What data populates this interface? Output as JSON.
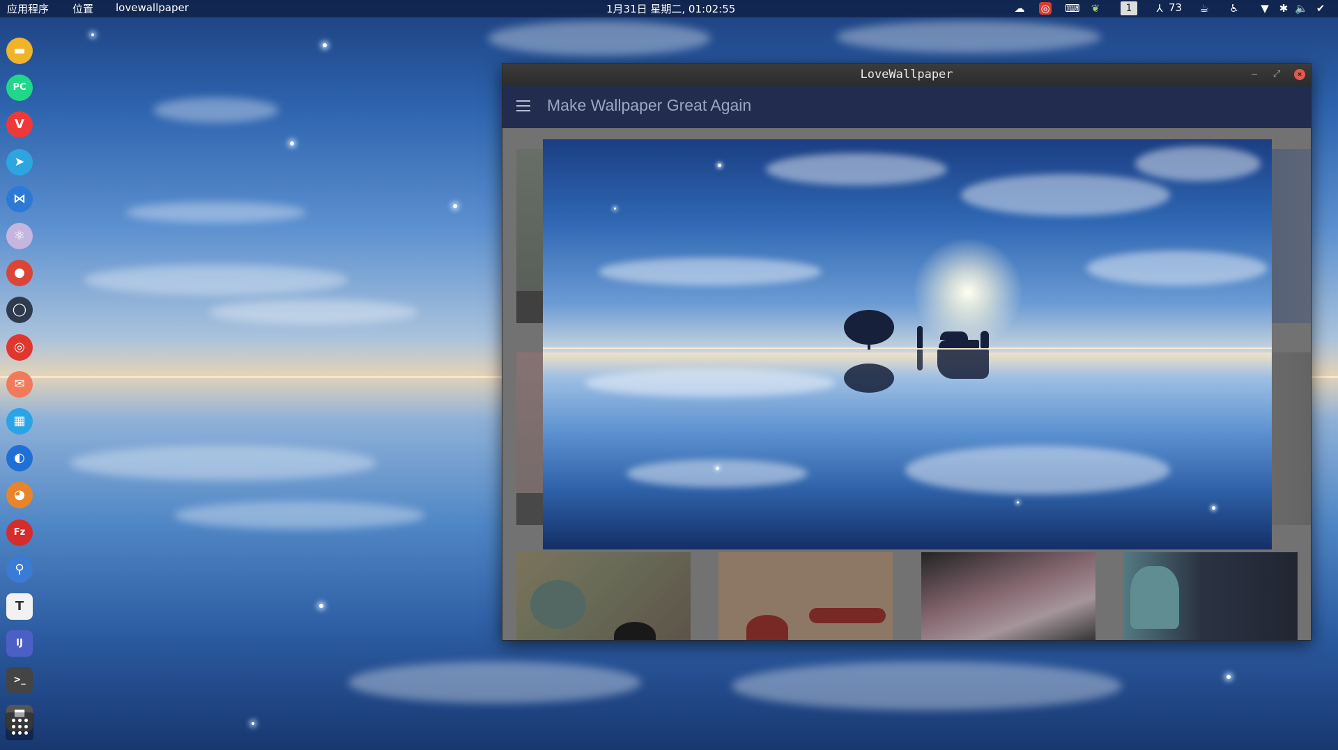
{
  "top_panel": {
    "applications": "应用程序",
    "places": "位置",
    "active_app": "lovewallpaper",
    "clock": "1月31日 星期二, 01:02:55",
    "workspace": "1",
    "temperature": "73"
  },
  "tray_icons": [
    "wechat-icon",
    "netease-music-icon",
    "keyboard-icon",
    "leaf-icon",
    "workspace-indicator",
    "temperature-icon",
    "coffee-icon",
    "accessibility-icon",
    "wifi-icon",
    "bluetooth-icon",
    "volume-icon",
    "clipboard-icon"
  ],
  "dock_icons": [
    {
      "name": "files",
      "glyph": "▬",
      "color": "#f0b429"
    },
    {
      "name": "pycharm",
      "glyph": "PC",
      "color": "#21d789"
    },
    {
      "name": "vivaldi",
      "glyph": "V",
      "color": "#ef3939"
    },
    {
      "name": "telegram",
      "glyph": "➤",
      "color": "#2ca5e0"
    },
    {
      "name": "vscode",
      "glyph": "⋈",
      "color": "#2d7ad6"
    },
    {
      "name": "atom",
      "glyph": "⚛",
      "color": "#c5b6e0"
    },
    {
      "name": "chrome",
      "glyph": "●",
      "color": "#db4437"
    },
    {
      "name": "chat-app",
      "glyph": "◯",
      "color": "#2f3b4d"
    },
    {
      "name": "netease-music",
      "glyph": "◎",
      "color": "#e0362d"
    },
    {
      "name": "mail",
      "glyph": "✉",
      "color": "#f07a5a"
    },
    {
      "name": "system-monitor",
      "glyph": "▦",
      "color": "#2aa4e6"
    },
    {
      "name": "firefox",
      "glyph": "◐",
      "color": "#1f6fd6"
    },
    {
      "name": "gimp",
      "glyph": "◕",
      "color": "#e8852a"
    },
    {
      "name": "filezilla",
      "glyph": "Fz",
      "color": "#d62c2c"
    },
    {
      "name": "search-tool",
      "glyph": "⚲",
      "color": "#3a7bd5"
    },
    {
      "name": "typora",
      "glyph": "T",
      "color": "#f2f2f2"
    },
    {
      "name": "intellij",
      "glyph": "IJ",
      "color": "#4c5fc4"
    },
    {
      "name": "terminal",
      "glyph": ">_",
      "color": "#444"
    },
    {
      "name": "paint-roller",
      "glyph": "▀",
      "color": "#555"
    }
  ],
  "window": {
    "title": "LoveWallpaper",
    "app_title": "Make Wallpaper Great Again",
    "minimize": "–",
    "maximize": "⤢",
    "close": "×"
  },
  "thumbnails_bottom": [
    "balloons-thumbnail",
    "red-rooster-thumbnail",
    "pink-art-thumbnail",
    "miku-thumbnail"
  ],
  "colors": {
    "appbar": "#222c4e",
    "titlebar": "#2c2c2c",
    "close_button": "#e05a4f"
  }
}
